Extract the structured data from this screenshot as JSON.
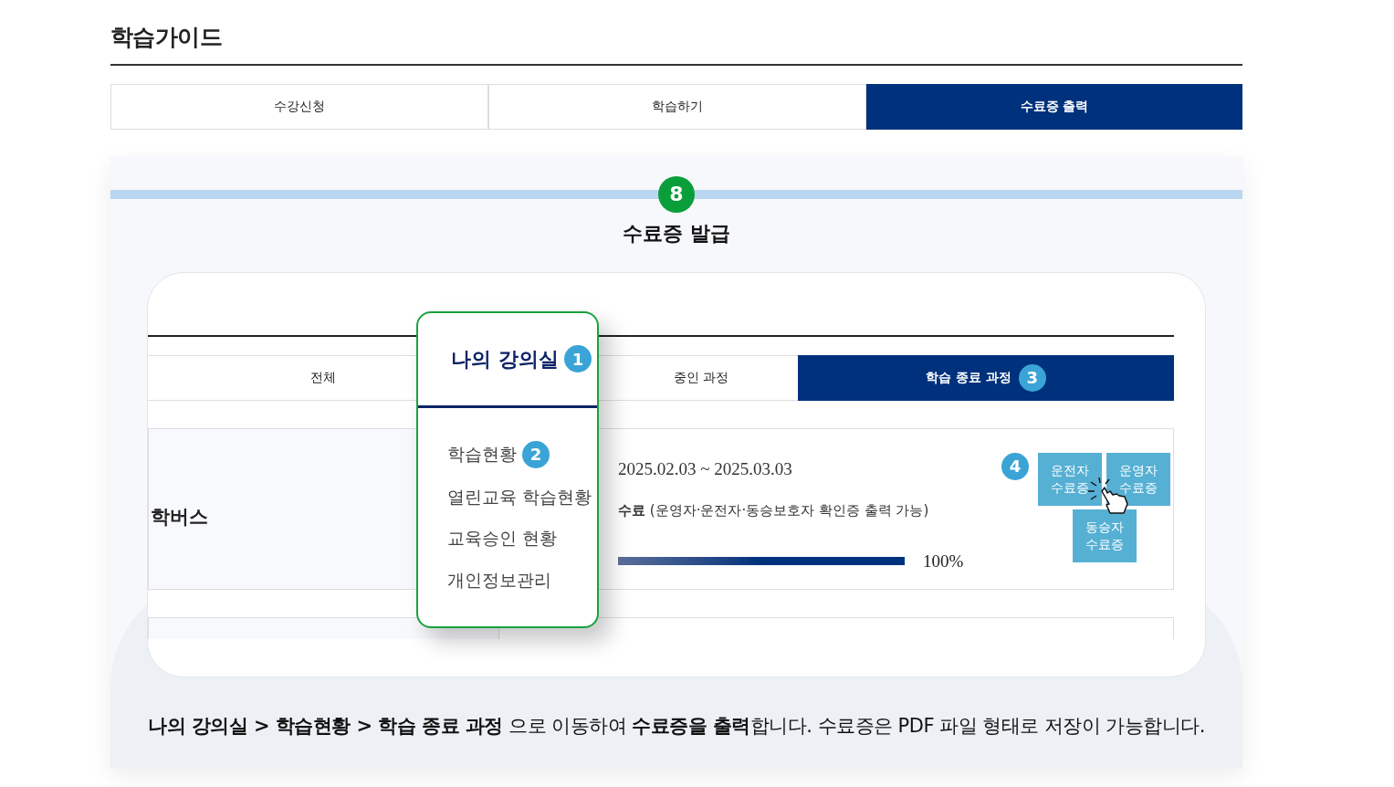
{
  "page_title": "학습가이드",
  "tabs": [
    {
      "label": "수강신청",
      "selected": false
    },
    {
      "label": "학습하기",
      "selected": false
    },
    {
      "label": "수료증 출력",
      "selected": true
    }
  ],
  "step": {
    "number": "8",
    "title": "수료증 발급"
  },
  "mock": {
    "tabs": [
      {
        "label": "전체",
        "selected": false
      },
      {
        "label": "중인 과정",
        "selected": false
      },
      {
        "label": "학습 종료 과정",
        "selected": true,
        "badge": "3"
      }
    ],
    "course": {
      "title_fragment": "학버스",
      "period": "2025.02.03 ~ 2025.03.03",
      "status": "수료",
      "status_note": "(운영자·운전자·동승보호자 확인증 출력 가능)",
      "level": 1,
      "percent": "100%",
      "badge": "4",
      "buttons": [
        "운전자 수료증",
        "운영자 수료증",
        "동승자 수료증"
      ]
    }
  },
  "menu": {
    "title": "나의 강의실",
    "badge": "1",
    "items": [
      {
        "label": "학습현황",
        "badge": "2"
      },
      {
        "label": "열린교육 학습현황"
      },
      {
        "label": "교육승인 현황"
      },
      {
        "label": "개인정보관리"
      }
    ]
  },
  "caption": "**나의 강의실 > 학습현황 > 학습 종료 과정** 으로 이동하여 **수료증을 출력**합니다. 수료증은 PDF 파일 형태로 저장이 가능합니다."
}
